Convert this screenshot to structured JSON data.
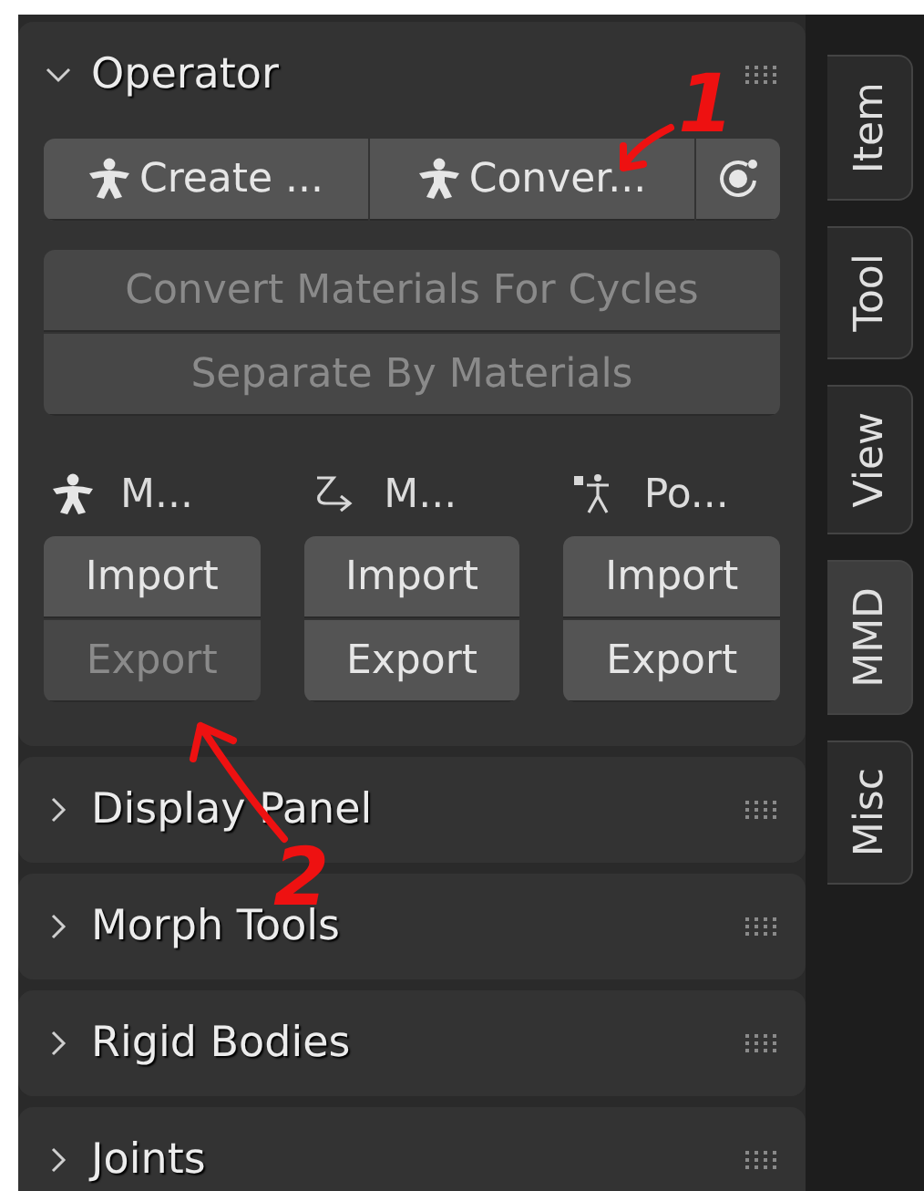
{
  "panels": [
    {
      "title": "Operator",
      "expanded": true,
      "top_row": [
        {
          "kind": "figure",
          "label": "Create ..."
        },
        {
          "kind": "figure",
          "label": "Conver..."
        },
        {
          "kind": "record"
        }
      ],
      "wide_buttons": [
        {
          "label": "Convert Materials For Cycles",
          "disabled": true
        },
        {
          "label": "Separate By Materials",
          "disabled": true
        }
      ],
      "io_columns": [
        {
          "kind": "figure",
          "label": "M...",
          "buttons": [
            {
              "label": "Import",
              "disabled": false
            },
            {
              "label": "Export",
              "disabled": true
            }
          ]
        },
        {
          "kind": "motion",
          "label": "M...",
          "buttons": [
            {
              "label": "Import",
              "disabled": false
            },
            {
              "label": "Export",
              "disabled": false
            }
          ]
        },
        {
          "kind": "pose",
          "label": "Po...",
          "buttons": [
            {
              "label": "Import",
              "disabled": false
            },
            {
              "label": "Export",
              "disabled": false
            }
          ]
        }
      ]
    },
    {
      "title": "Display Panel",
      "expanded": false
    },
    {
      "title": "Morph Tools",
      "expanded": false
    },
    {
      "title": "Rigid Bodies",
      "expanded": false
    },
    {
      "title": "Joints",
      "expanded": false
    }
  ],
  "tabs": [
    {
      "label": "Item",
      "selected": false
    },
    {
      "label": "Tool",
      "selected": false
    },
    {
      "label": "View",
      "selected": false
    },
    {
      "label": "MMD",
      "selected": true
    },
    {
      "label": "Misc",
      "selected": false
    }
  ],
  "annotations": [
    {
      "label": "1"
    },
    {
      "label": "2"
    }
  ]
}
